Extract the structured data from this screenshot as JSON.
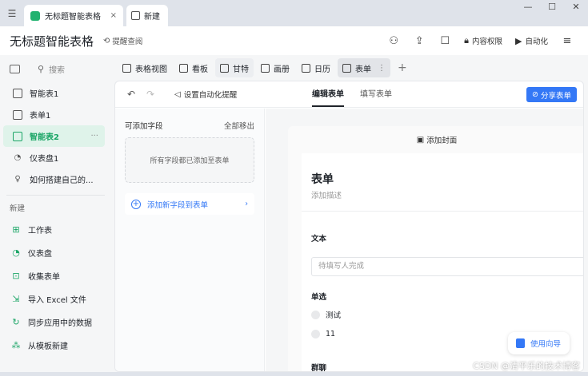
{
  "titlebar": {
    "tabs": [
      {
        "label": "无标题智能表格",
        "close": "×"
      },
      {
        "label": "新建"
      }
    ],
    "controls": {
      "min": "—",
      "max": "☐",
      "close": "✕"
    }
  },
  "header": {
    "title": "无标题智能表格",
    "remind": "提醒查阅",
    "content_permission": "内容权限",
    "automation": "自动化"
  },
  "sidebar": {
    "search": "搜索",
    "items": [
      {
        "label": "智能表1"
      },
      {
        "label": "表单1"
      },
      {
        "label": "智能表2",
        "more": "···"
      },
      {
        "label": "仪表盘1"
      },
      {
        "label": "如何搭建自己的..."
      }
    ],
    "new_section": "新建",
    "new_items": [
      {
        "label": "工作表"
      },
      {
        "label": "仪表盘"
      },
      {
        "label": "收集表单"
      },
      {
        "label": "导入 Excel 文件"
      },
      {
        "label": "同步应用中的数据"
      },
      {
        "label": "从模板新建"
      }
    ]
  },
  "views": [
    {
      "label": "表格视图"
    },
    {
      "label": "看板"
    },
    {
      "label": "甘特"
    },
    {
      "label": "画册"
    },
    {
      "label": "日历"
    },
    {
      "label": "表单"
    }
  ],
  "toolbar": {
    "auto_remind": "设置自动化提醒",
    "tab_edit": "编辑表单",
    "tab_fill": "填写表单",
    "share": "分享表单"
  },
  "fieldpanel": {
    "title": "可添加字段",
    "remove_all": "全部移出",
    "empty_msg": "所有字段都已添加至表单",
    "add_field": "添加新字段到表单"
  },
  "form": {
    "add_cover": "添加封面",
    "title": "表单",
    "desc": "添加描述",
    "q1_label": "文本",
    "q1_placeholder": "待填写人完成",
    "q2_label": "单选",
    "q2_options": [
      "测试",
      "11"
    ],
    "q3_label": "群聊"
  },
  "guide": "使用向导",
  "watermark": "CSDN @清平乐的技术博客",
  "colors": {
    "accent": "#3478f6",
    "green": "#1aa566"
  }
}
